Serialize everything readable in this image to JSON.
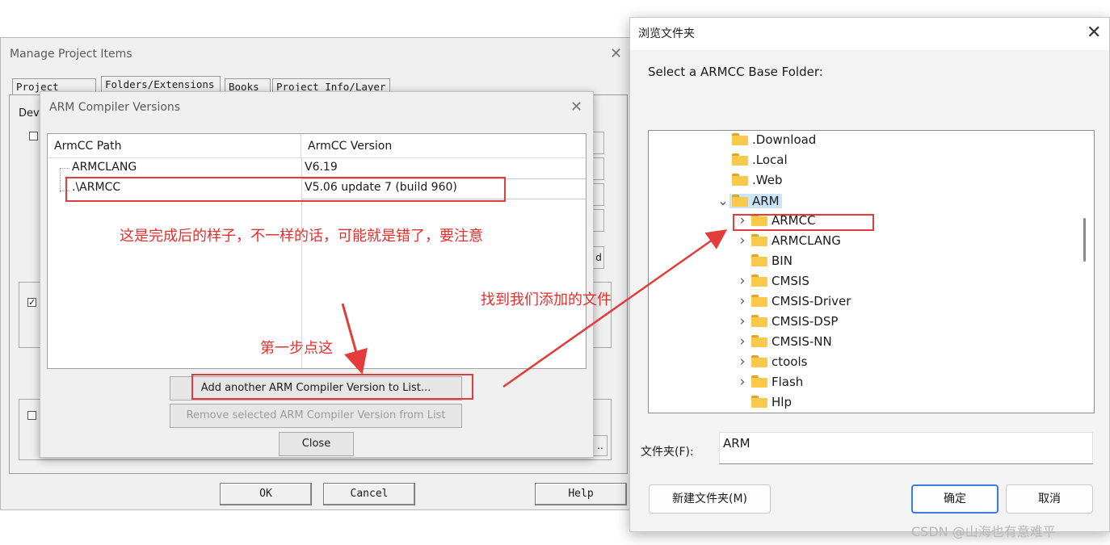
{
  "manage_window": {
    "title": "Manage Project Items",
    "tabs": [
      "Project Items",
      "Folders/Extensions",
      "Books",
      "Project Info/Layer"
    ],
    "partial_label": "Dev",
    "partial_d": "d",
    "partial_dots": "..",
    "buttons": {
      "ok": "OK",
      "cancel": "Cancel",
      "help": "Help"
    }
  },
  "arm_dialog": {
    "title": "ARM Compiler Versions",
    "columns": {
      "path": "ArmCC Path",
      "version": "ArmCC Version"
    },
    "rows": [
      {
        "path": "ARMCLANG",
        "version": "V6.19"
      },
      {
        "path": ".\\ARMCC",
        "version": "V5.06 update 7 (build 960)"
      }
    ],
    "buttons": {
      "add": "Add another ARM Compiler Version to List...",
      "remove": "Remove selected ARM Compiler Version from List",
      "close": "Close"
    }
  },
  "browse_dialog": {
    "title": "浏览文件夹",
    "prompt": "Select a ARMCC Base Folder:",
    "tree": [
      {
        "label": ".Download",
        "level": 0,
        "expander": ""
      },
      {
        "label": ".Local",
        "level": 0,
        "expander": ""
      },
      {
        "label": ".Web",
        "level": 0,
        "expander": ""
      },
      {
        "label": "ARM",
        "level": 0,
        "expander": "expanded",
        "selected": true
      },
      {
        "label": "ARMCC",
        "level": 1,
        "expander": "collapsed"
      },
      {
        "label": "ARMCLANG",
        "level": 1,
        "expander": "collapsed"
      },
      {
        "label": "BIN",
        "level": 1,
        "expander": ""
      },
      {
        "label": "CMSIS",
        "level": 1,
        "expander": "collapsed"
      },
      {
        "label": "CMSIS-Driver",
        "level": 1,
        "expander": "collapsed"
      },
      {
        "label": "CMSIS-DSP",
        "level": 1,
        "expander": "collapsed"
      },
      {
        "label": "CMSIS-NN",
        "level": 1,
        "expander": "collapsed"
      },
      {
        "label": "ctools",
        "level": 1,
        "expander": "collapsed"
      },
      {
        "label": "Flash",
        "level": 1,
        "expander": "collapsed"
      },
      {
        "label": "Hlp",
        "level": 1,
        "expander": ""
      }
    ],
    "folder_label": "文件夹(F):",
    "folder_value": "ARM",
    "buttons": {
      "new_folder": "新建文件夹(M)",
      "ok": "确定",
      "cancel": "取消"
    }
  },
  "annotations": {
    "result_note": "这是完成后的样子，不一样的话，可能就是错了，要注意",
    "find_note": "找到我们添加的文件",
    "step_note": "第一步点这"
  },
  "watermark": "CSDN @山海也有意难平",
  "colors": {
    "annotation_red": "#e43b3b",
    "selection_blue": "#cce4f7",
    "primary_border": "#3d7bd9"
  }
}
